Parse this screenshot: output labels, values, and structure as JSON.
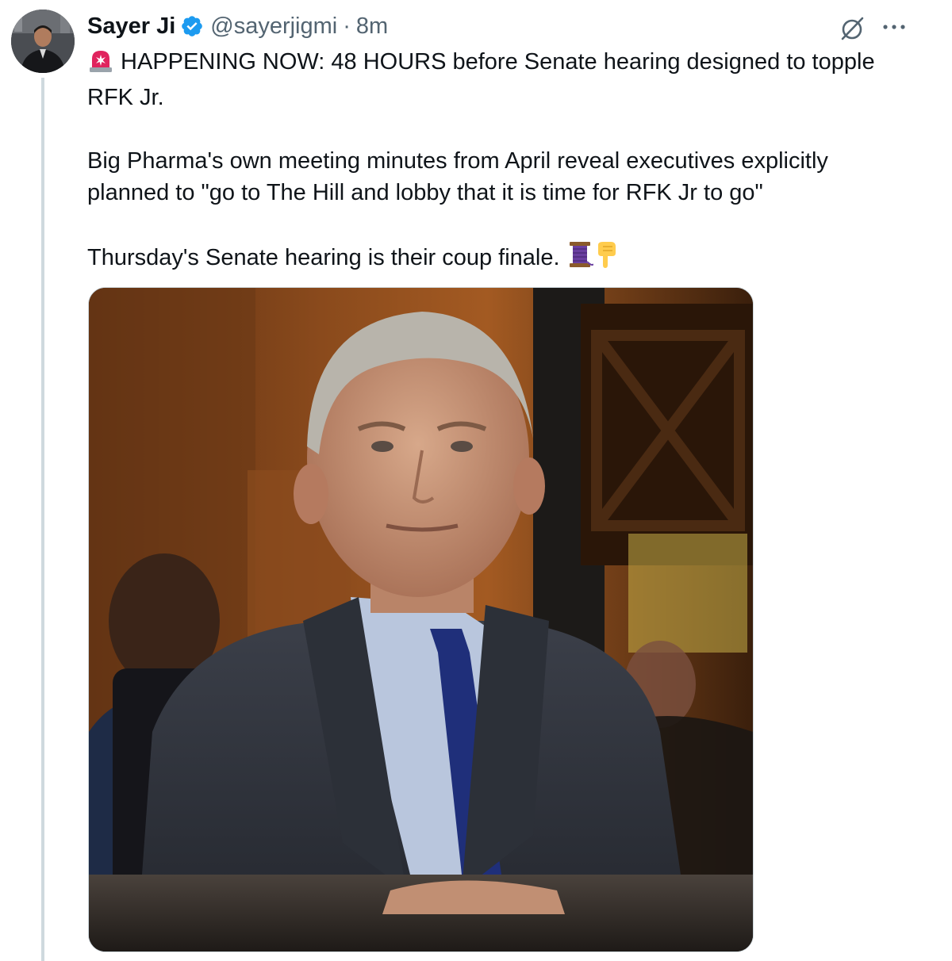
{
  "tweet": {
    "author_name": "Sayer Ji",
    "author_handle": "@sayerjigmi",
    "separator": "·",
    "time": "8m",
    "verified_icon": "verified-badge-icon",
    "paragraphs": [
      " HAPPENING NOW: 48 HOURS before Senate hearing  designed to topple RFK Jr.",
      "Big Pharma's own meeting minutes from April reveal executives explicitly planned to \"go to The Hill and lobby that it is time for RFK Jr to go\"",
      "Thursday's Senate hearing is their coup finale. "
    ],
    "emojis": {
      "lead": "rotating-light-emoji",
      "trail_1": "thread-spool-emoji",
      "trail_2": "pointing-down-emoji"
    }
  },
  "actions": {
    "grok_icon": "grok-icon",
    "more_icon": "more-icon"
  },
  "colors": {
    "text": "#0f1419",
    "secondary": "#536471",
    "verified": "#1d9bf0",
    "border": "#cfd9de"
  }
}
